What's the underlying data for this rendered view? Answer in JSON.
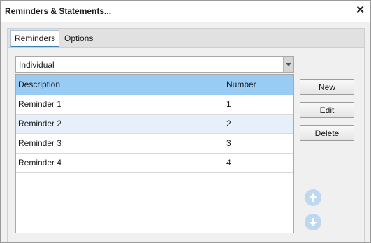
{
  "window": {
    "title": "Reminders & Statements...",
    "close_glyph": "✕"
  },
  "tabs": [
    {
      "label": "Reminders",
      "active": true
    },
    {
      "label": "Options",
      "active": false
    }
  ],
  "filter": {
    "selected": "Individual"
  },
  "grid": {
    "columns": [
      "Description",
      "Number"
    ],
    "rows": [
      {
        "description": "Reminder 1",
        "number": "1"
      },
      {
        "description": "Reminder 2",
        "number": "2"
      },
      {
        "description": "Reminder 3",
        "number": "3"
      },
      {
        "description": "Reminder 4",
        "number": "4"
      }
    ]
  },
  "buttons": {
    "new_label": "New",
    "edit_label": "Edit",
    "delete_label": "Delete"
  },
  "icons": {
    "move_up": "arrow-up-icon",
    "move_down": "arrow-down-icon"
  },
  "colors": {
    "header_bg": "#99ccf5",
    "alt_row_bg": "#e6effa",
    "arrow_disabled": "#bcd9f1",
    "tab_accent": "#3c7fb1"
  }
}
